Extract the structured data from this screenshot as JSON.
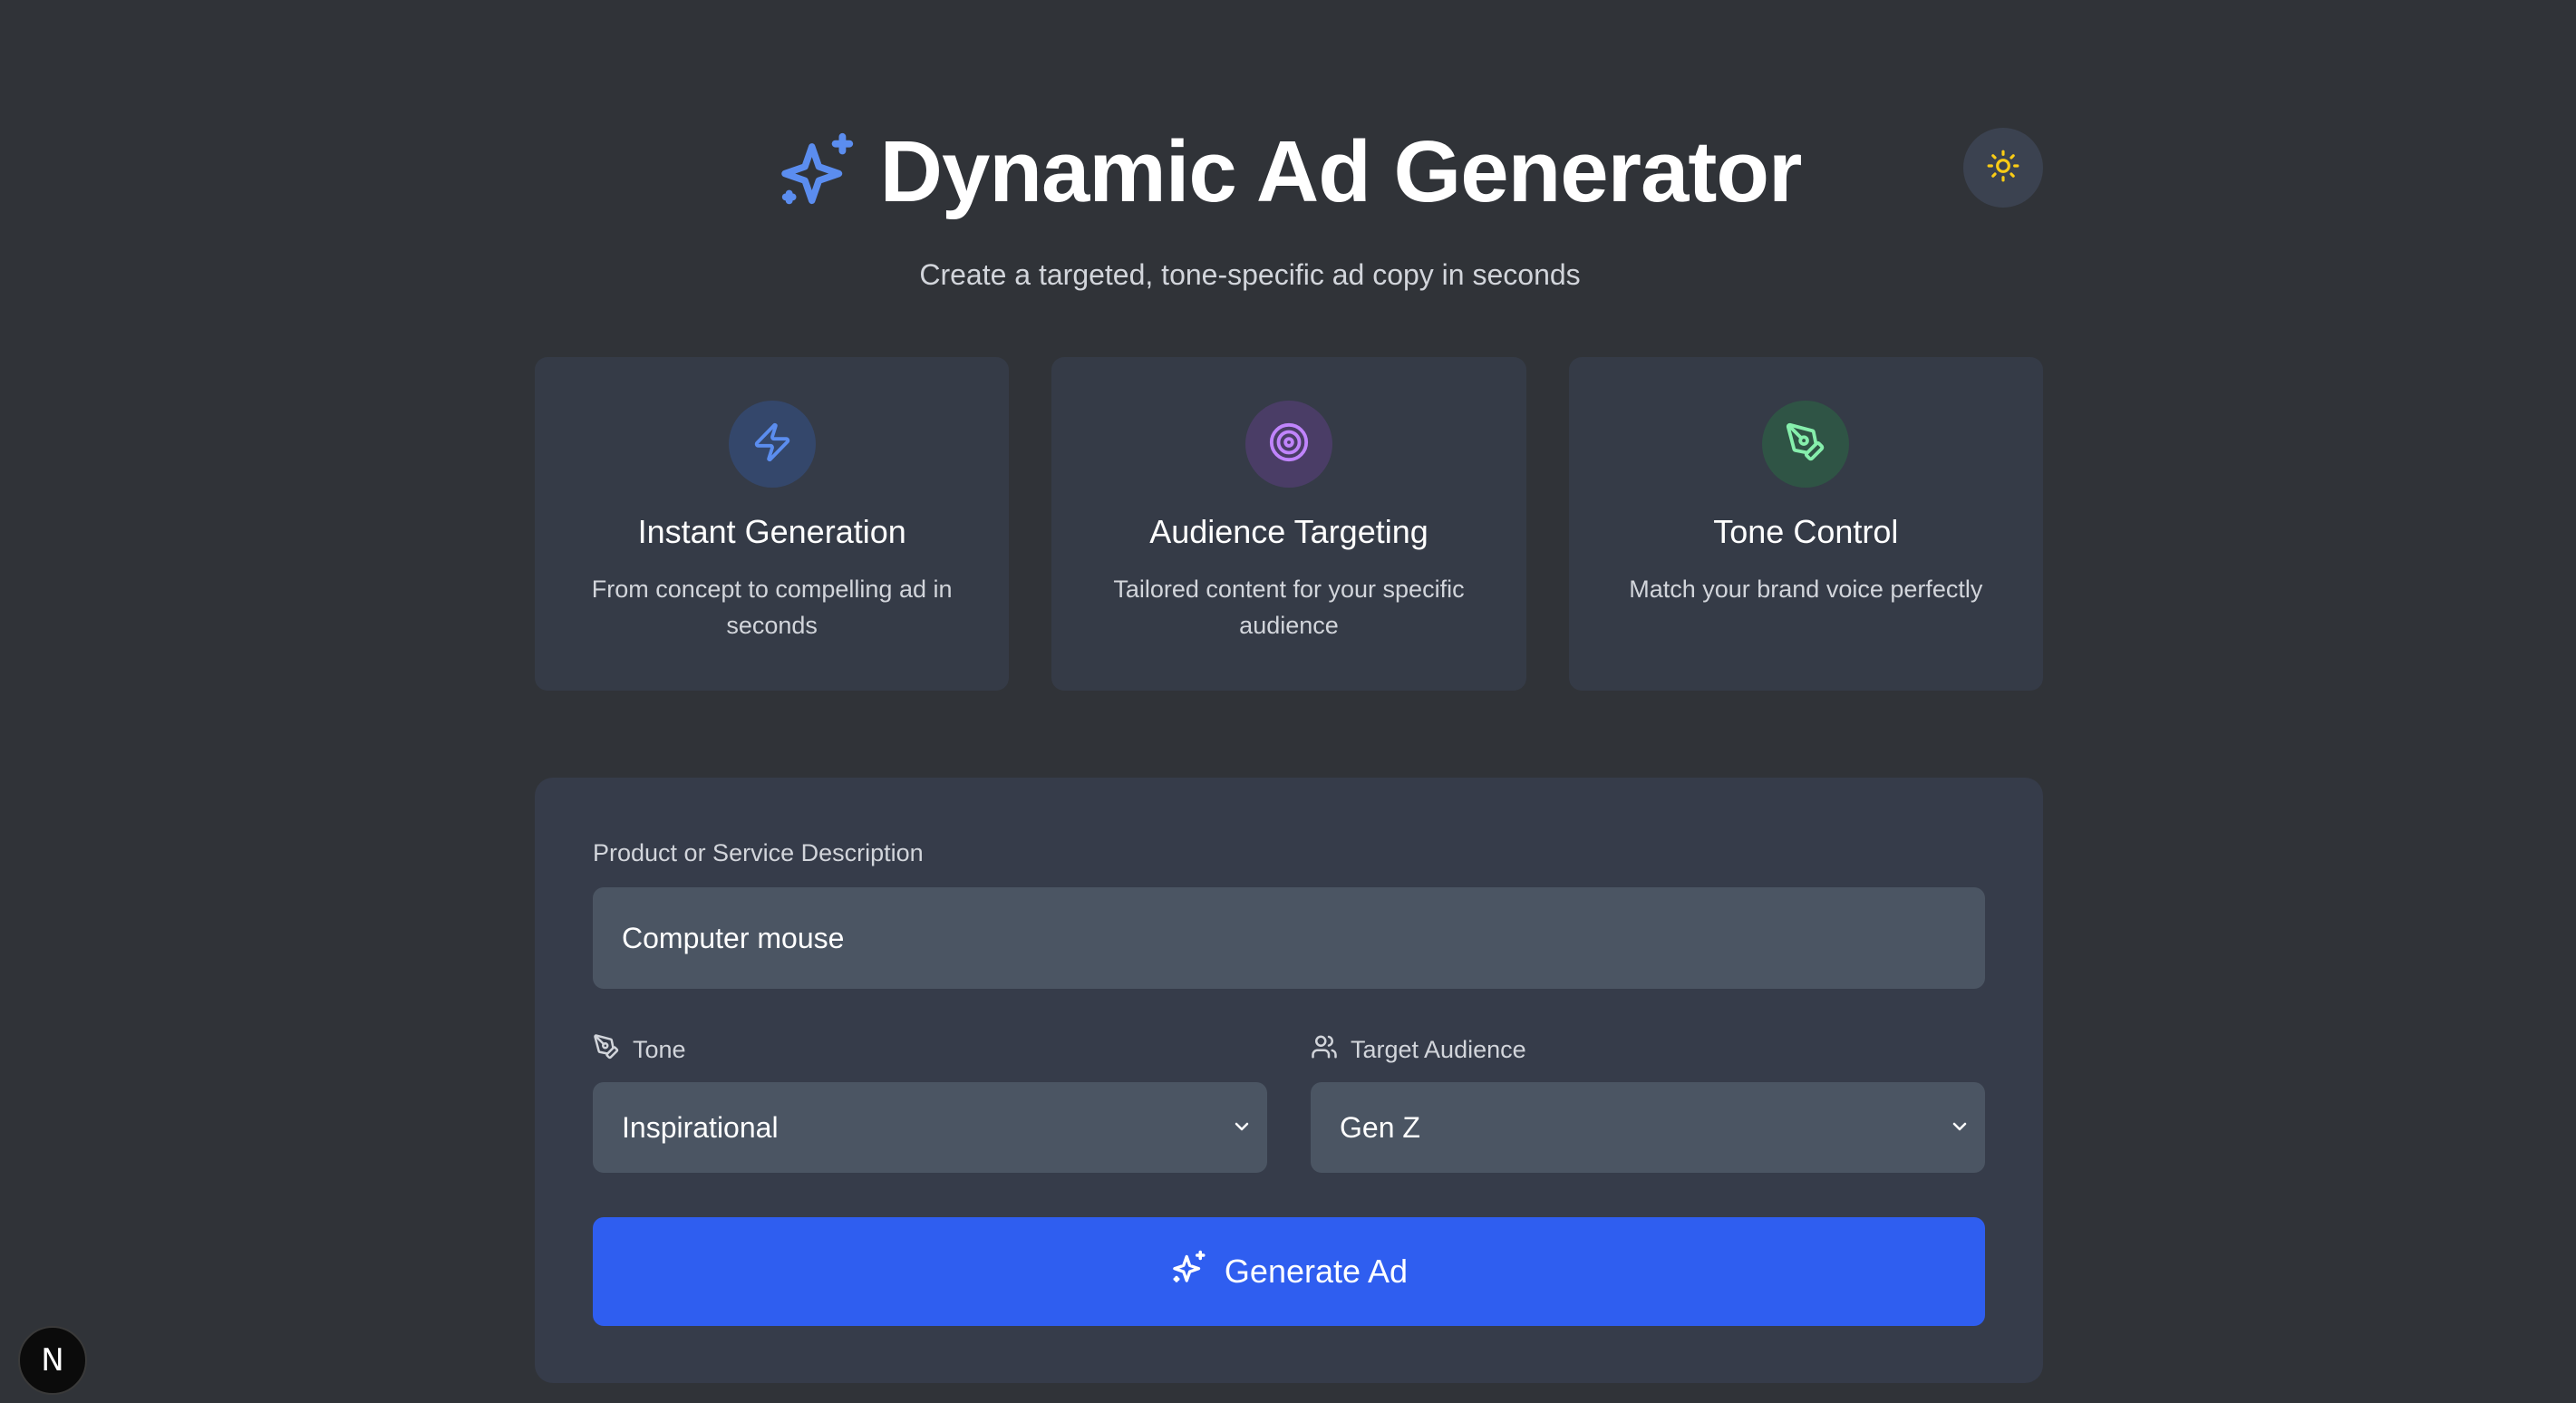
{
  "header": {
    "title": "Dynamic Ad Generator",
    "subtitle": "Create a targeted, tone-specific ad copy in seconds",
    "title_icon": "sparkles-icon",
    "theme_toggle_icon": "sun-icon"
  },
  "features": [
    {
      "icon": "zap-icon",
      "title": "Instant Generation",
      "description": "From concept to compelling ad in seconds"
    },
    {
      "icon": "target-icon",
      "title": "Audience Targeting",
      "description": "Tailored content for your specific audience"
    },
    {
      "icon": "pen-tool-icon",
      "title": "Tone Control",
      "description": "Match your brand voice perfectly"
    }
  ],
  "form": {
    "description_label": "Product or Service Description",
    "description_value": "Computer mouse",
    "tone_label": "Tone",
    "tone_value": "Inspirational",
    "audience_label": "Target Audience",
    "audience_value": "Gen Z",
    "generate_label": "Generate Ad"
  },
  "badge": {
    "letter": "N"
  },
  "colors": {
    "background": "#303338",
    "card": "#353b47",
    "input": "#4b5563",
    "primary": "#2f5ef0",
    "accent_blue": "#5b8def",
    "accent_purple": "#c084fc",
    "accent_green": "#86efac",
    "sun_yellow": "#facc15"
  }
}
